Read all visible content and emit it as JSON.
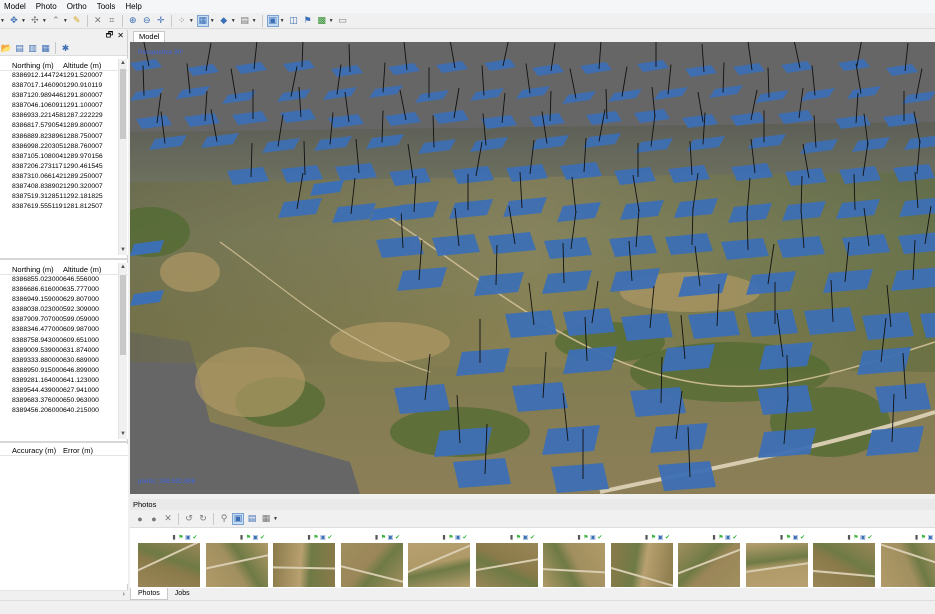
{
  "menu": [
    "Model",
    "Photo",
    "Ortho",
    "Tools",
    "Help"
  ],
  "left_panel": {
    "header_icons": [
      "restore-icon",
      "close-icon"
    ],
    "camera_table": {
      "columns": [
        "Northing (m)",
        "Altitude (m)"
      ],
      "rows": [
        [
          "8386912.144724",
          "1291.520007"
        ],
        [
          "8387017.146090",
          "1290.910119"
        ],
        [
          "8387120.989446",
          "1291.800007"
        ],
        [
          "8387046.106091",
          "1291.100007"
        ],
        [
          "8386933.221458",
          "1287.222229"
        ],
        [
          "8386817.579054",
          "1289.800007"
        ],
        [
          "8386889.823896",
          "1288.750007"
        ],
        [
          "8386998.220305",
          "1288.760007"
        ],
        [
          "8387105.108004",
          "1289.970156"
        ],
        [
          "8387206.273117",
          "1290.461545"
        ],
        [
          "8387310.066142",
          "1289.250007"
        ],
        [
          "8387408.838902",
          "1290.320007"
        ],
        [
          "8387519.312851",
          "1292.181825"
        ],
        [
          "8387619.555119",
          "1281.812507"
        ]
      ]
    },
    "marker_table": {
      "columns": [
        "Northing (m)",
        "Altitude (m)"
      ],
      "rows": [
        [
          "8386855.023000",
          "646.556000"
        ],
        [
          "8386686.616000",
          "635.777000"
        ],
        [
          "8386949.159000",
          "629.807000"
        ],
        [
          "8388038.023000",
          "592.309000"
        ],
        [
          "8387909.707000",
          "599.059000"
        ],
        [
          "8388346.477000",
          "609.987000"
        ],
        [
          "8388758.943000",
          "609.651000"
        ],
        [
          "8389009.539000",
          "631.874000"
        ],
        [
          "8389333.880000",
          "630.689000"
        ],
        [
          "8388950.915000",
          "646.899000"
        ],
        [
          "8389281.164000",
          "641.123000"
        ],
        [
          "8389544.439000",
          "627.941000"
        ],
        [
          "8389683.376000",
          "650.963000"
        ],
        [
          "8389456.206000",
          "640.215000"
        ]
      ]
    },
    "scale_table": {
      "columns": [
        "Accuracy (m)",
        "Error (m)"
      ]
    }
  },
  "model_view": {
    "tab_label": "Model",
    "projection_label": "Perspective 30°",
    "points_label": "points: 248,592,808"
  },
  "photos_panel": {
    "title": "Photos",
    "thumbnail_count": 12,
    "bottom_tabs": [
      "Photos",
      "Jobs"
    ],
    "active_tab": "Photos"
  },
  "colors": {
    "camera_plane": "#3d6fb4",
    "view_label": "#3a63e0",
    "badge_green": "#3bb23b"
  }
}
